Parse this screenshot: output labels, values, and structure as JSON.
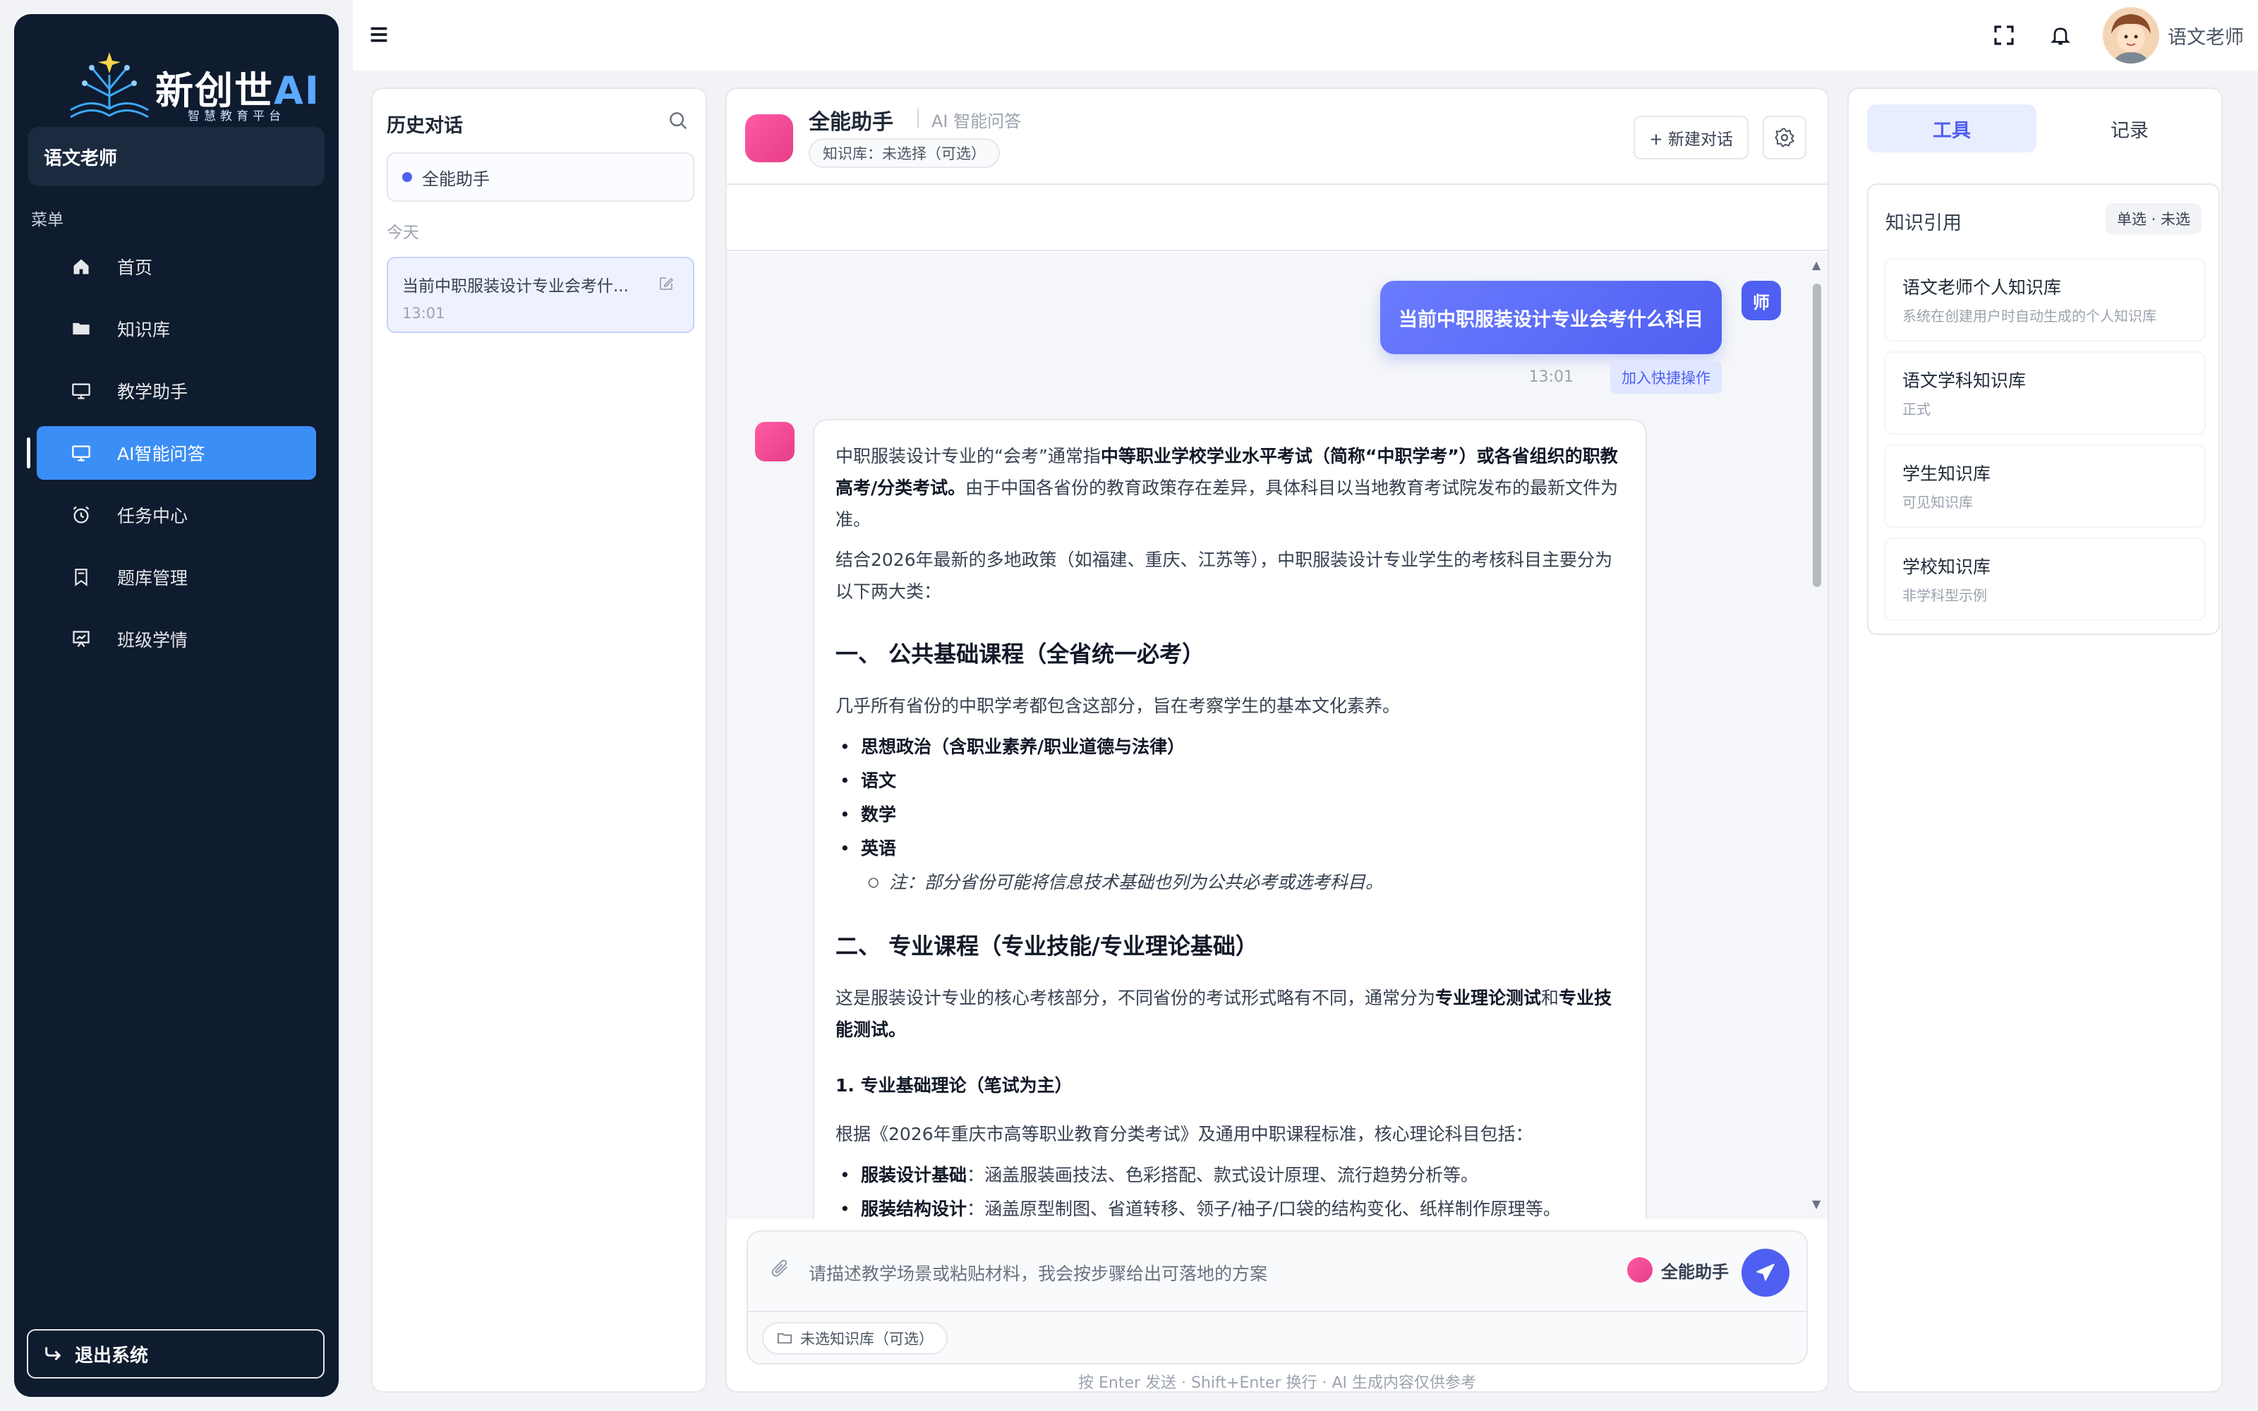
{
  "brand": {
    "title_main": "新创世",
    "title_ai": "AI",
    "subtitle": "智慧教育平台"
  },
  "sidebar": {
    "user": "语文老师",
    "menu_label": "菜单",
    "items": [
      {
        "label": "首页",
        "icon": "home-icon"
      },
      {
        "label": "知识库",
        "icon": "folder-icon"
      },
      {
        "label": "教学助手",
        "icon": "monitor-icon"
      },
      {
        "label": "AI智能问答",
        "icon": "monitor-icon",
        "active": true
      },
      {
        "label": "任务中心",
        "icon": "alarm-icon"
      },
      {
        "label": "题库管理",
        "icon": "bookmark-icon"
      },
      {
        "label": "班级学情",
        "icon": "chart-board-icon"
      }
    ],
    "logout": "退出系统"
  },
  "topbar": {
    "username": "语文老师"
  },
  "history": {
    "title": "历史对话",
    "assistant": "全能助手",
    "date_group": "今天",
    "items": [
      {
        "title": "当前中职服装设计专业会考什...",
        "time": "13:01"
      }
    ]
  },
  "chat": {
    "name": "全能助手",
    "subtitle": "AI 智能问答",
    "kb_pill": "知识库：未选择（可选）",
    "new_chat": "+ 新建对话",
    "user_message": "当前中职服装设计专业会考什么科目",
    "user_avatar": "师",
    "msg_time": "13:01",
    "quick_add": "加入快捷操作",
    "answer": {
      "p1_a": "中职服装设计专业的“会考”通常指",
      "p1_b": "中等职业学校学业水平考试（简称“中职学考”）或各省组织的职教高考/分类考试。",
      "p1_c": "由于中国各省份的教育政策存在差异，具体科目以当地教育考试院发布的最新文件为准。",
      "p2": "结合2026年最新的多地政策（如福建、重庆、江苏等），中职服装设计专业学生的考核科目主要分为以下两大类：",
      "h1": "一、 公共基础课程（全省统一必考）",
      "p3": "几乎所有省份的中职学考都包含这部分，旨在考察学生的基本文化素养。",
      "list1": [
        "思想政治（含职业素养/职业道德与法律）",
        "语文",
        "数学",
        "英语"
      ],
      "note": "注：部分省份可能将信息技术基础也列为公共必考或选考科目。",
      "h2": "二、 专业课程（专业技能/专业理论基础）",
      "p4_a": "这是服装设计专业的核心考核部分，不同省份的考试形式略有不同，通常分为",
      "p4_b": "专业理论测试",
      "p4_c": "和",
      "p4_d": "专业技能测试。",
      "h3": "1. 专业基础理论（笔试为主）",
      "p5": "根据《2026年重庆市高等职业教育分类考试》及通用中职课程标准，核心理论科目包括：",
      "li_a_label": "服装设计基础",
      "li_a_text": "：涵盖服装画技法、色彩搭配、款式设计原理、流行趋势分析等。",
      "li_b_label": "服装结构设计",
      "li_b_text": "：涵盖原型制图、省道转移、领子/袖子/口袋的结构变化、纸样制作原理等。"
    },
    "composer": {
      "placeholder": "请描述教学场景或粘贴材料，我会按步骤给出可落地的方案",
      "mode": "全能助手",
      "kb_select": "未选知识库（可选）"
    },
    "footer": "按 Enter 发送 · Shift+Enter 换行 · AI 生成内容仅供参考"
  },
  "right_panel": {
    "tabs": [
      "工具",
      "记录"
    ],
    "kref_title": "知识引用",
    "kref_badge": "单选 · 未选",
    "kbs": [
      {
        "name": "语文老师个人知识库",
        "desc": "系统在创建用户时自动生成的个人知识库"
      },
      {
        "name": "语文学科知识库",
        "desc": "正式"
      },
      {
        "name": "学生知识库",
        "desc": "可见知识库"
      },
      {
        "name": "学校知识库",
        "desc": "非学科型示例"
      }
    ]
  },
  "colors": {
    "sidebar_bg": "#0f1b2e",
    "accent": "#4f5ff1",
    "active_nav": "#3b8ef5",
    "bot_pink": "#e63e87"
  }
}
